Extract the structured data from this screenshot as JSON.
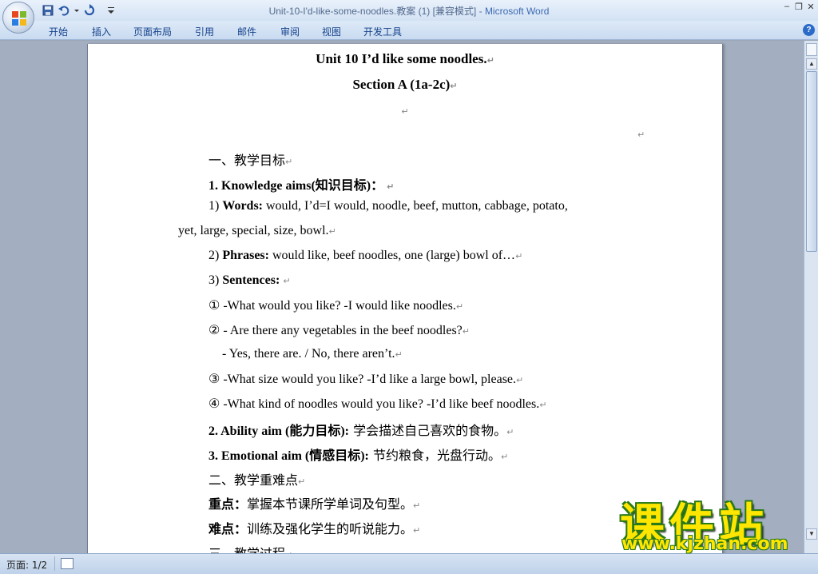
{
  "window": {
    "title_doc": "Unit-10-I'd-like-some-noodles.教案 (1) [兼容模式] - ",
    "title_app": "Microsoft Word",
    "controls": [
      "–",
      "❐",
      "✕"
    ]
  },
  "ribbon": {
    "tabs": [
      "开始",
      "插入",
      "页面布局",
      "引用",
      "邮件",
      "审阅",
      "视图",
      "开发工具"
    ],
    "help": "?"
  },
  "document": {
    "title": "Unit 10 I’d like some noodles.",
    "section": "Section A (1a-2c)",
    "mark": "↵",
    "h1": "一、教学目标",
    "k_label": "1. Knowledge aims(知识目标)：",
    "w_num": "1) ",
    "w_label": "Words:",
    "w_text1": " would, I’d=I would, noodle, beef, mutton, cabbage, potato,",
    "w_text2": "yet, large, special, size, bowl.",
    "p_num": "2) ",
    "p_label": "Phrases:",
    "p_text": " would like, beef noodles, one (large)    bowl of…",
    "s_num": "3) ",
    "s_label": "Sentences:",
    "s1": "① -What would you like? -I would like noodles.",
    "s2": "② - Are there any vegetables in the beef noodles?",
    "s2b": "- Yes, there are. / No, there aren’t.",
    "s3": "③ -What size would you like? -I’d like a large bowl, please.",
    "s4": "④ -What kind of noodles would you like? -I’d like beef noodles.",
    "a_label": "2. Ability aim (能力目标):",
    "a_text": " 学会描述自己喜欢的食物。",
    "e_label": "3. Emotional aim (情感目标):",
    "e_text": " 节约粮食，光盘行动。",
    "h2": "二、教学重难点",
    "key_label": "重点：",
    "key_text": "掌握本节课所学单词及句型。",
    "diff_label": "难点：",
    "diff_text": "训练及强化学生的听说能力。",
    "h3": "三、教学过程"
  },
  "status": {
    "page": "页面: 1/2"
  },
  "watermark": {
    "big": "课件站",
    "url": "www.kjzhan.com"
  }
}
